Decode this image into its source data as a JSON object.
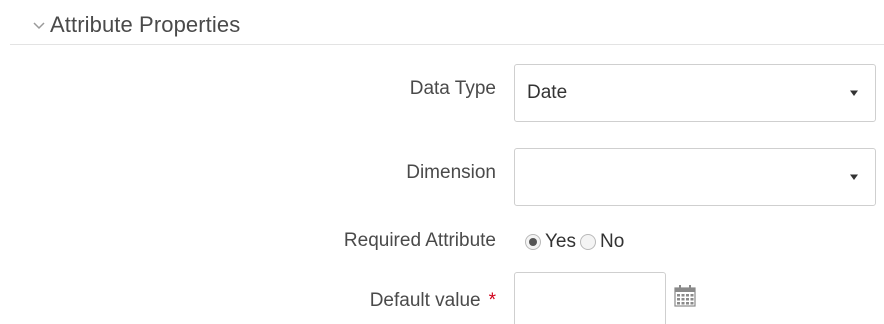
{
  "section": {
    "title": "Attribute Properties",
    "collapse_icon": "chevron-down-icon"
  },
  "fields": {
    "data_type": {
      "label": "Data Type",
      "value": "Date",
      "arrow_icon": "caret-down-icon"
    },
    "dimension": {
      "label": "Dimension",
      "value": "",
      "arrow_icon": "caret-down-icon"
    },
    "required_attribute": {
      "label": "Required Attribute",
      "options": [
        "Yes",
        "No"
      ],
      "selected": "Yes"
    },
    "default_value": {
      "label": "Default value",
      "required_marker": "*",
      "value": "",
      "calendar_icon": "calendar-icon"
    }
  },
  "colors": {
    "required_star": "#d0021b",
    "border": "#cfcfcf",
    "text": "#4a4a4a"
  }
}
